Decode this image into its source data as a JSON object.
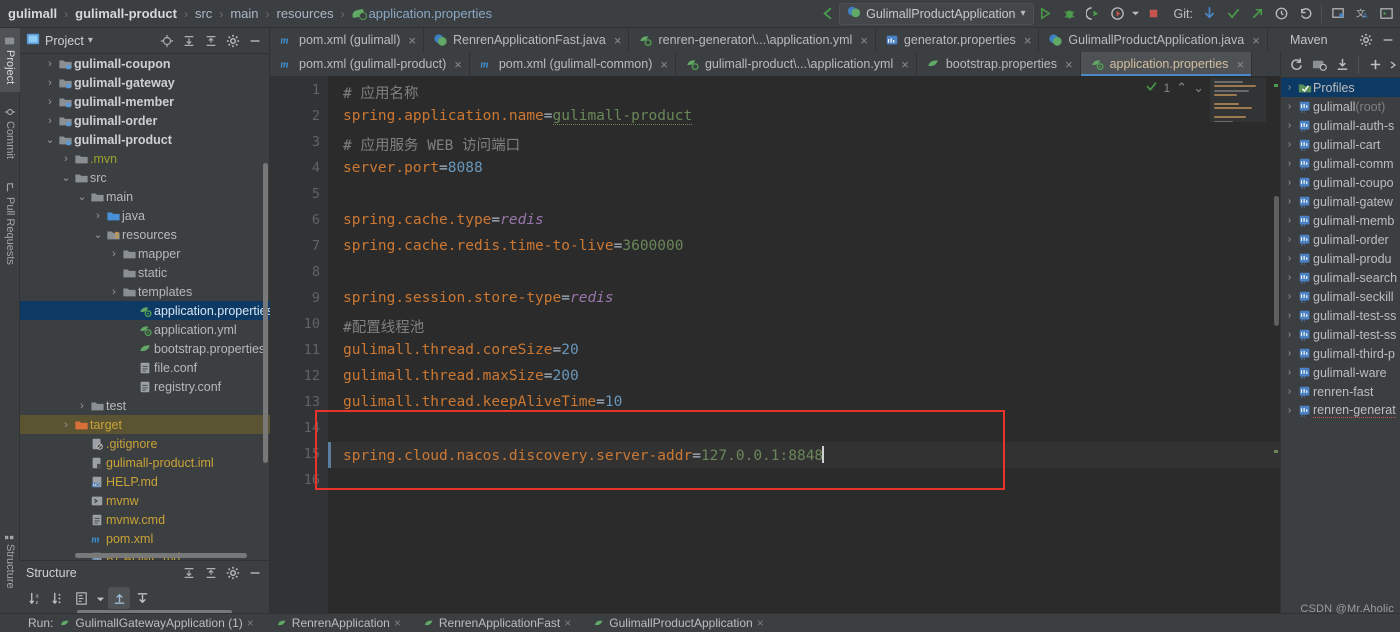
{
  "breadcrumb": {
    "items": [
      "gulimall",
      "gulimall-product",
      "src",
      "main",
      "resources",
      "application.properties"
    ],
    "separator": "›"
  },
  "toolbar": {
    "run_config": "GulimallProductApplication",
    "dropdown_caret": "▾",
    "git_label": "Git:",
    "icons": [
      "back-arrow-icon",
      "run-icon",
      "debug-icon",
      "run-with-coverage-icon",
      "profile-icon",
      "stop-icon",
      "git-update-icon",
      "git-commit-icon",
      "git-push-icon",
      "git-history-icon",
      "git-rollback-icon",
      "search-everywhere-icon",
      "translate-icon",
      "layout-icon"
    ]
  },
  "left_rail": {
    "items": [
      {
        "label": "Project",
        "selected": true
      },
      {
        "label": "Commit",
        "selected": false
      },
      {
        "label": "Pull Requests",
        "selected": false
      }
    ],
    "structure_label": "Structure"
  },
  "project_panel": {
    "title": "Project",
    "caret": "▾",
    "header_icons": [
      "locate-icon",
      "expand-all-icon",
      "collapse-all-icon",
      "settings-icon",
      "hide-icon"
    ],
    "tree": [
      {
        "label": "gulimall-coupon",
        "indent": 1,
        "arrow": "›",
        "icon": "module-folder-icon",
        "bold": true
      },
      {
        "label": "gulimall-gateway",
        "indent": 1,
        "arrow": "›",
        "icon": "module-folder-icon",
        "bold": true
      },
      {
        "label": "gulimall-member",
        "indent": 1,
        "arrow": "›",
        "icon": "module-folder-icon",
        "bold": true
      },
      {
        "label": "gulimall-order",
        "indent": 1,
        "arrow": "›",
        "icon": "module-folder-icon",
        "bold": true
      },
      {
        "label": "gulimall-product",
        "indent": 1,
        "arrow": "⌄",
        "icon": "module-folder-icon",
        "bold": true
      },
      {
        "label": ".mvn",
        "indent": 2,
        "arrow": "›",
        "icon": "folder-icon",
        "color": "green"
      },
      {
        "label": "src",
        "indent": 2,
        "arrow": "⌄",
        "icon": "folder-icon"
      },
      {
        "label": "main",
        "indent": 3,
        "arrow": "⌄",
        "icon": "folder-icon"
      },
      {
        "label": "java",
        "indent": 4,
        "arrow": "›",
        "icon": "source-folder-icon"
      },
      {
        "label": "resources",
        "indent": 4,
        "arrow": "⌄",
        "icon": "resources-folder-icon"
      },
      {
        "label": "mapper",
        "indent": 5,
        "arrow": "›",
        "icon": "folder-icon"
      },
      {
        "label": "static",
        "indent": 5,
        "arrow": "",
        "icon": "folder-icon"
      },
      {
        "label": "templates",
        "indent": 5,
        "arrow": "›",
        "icon": "folder-icon"
      },
      {
        "label": "application.properties",
        "indent": 6,
        "arrow": "",
        "icon": "spring-properties-icon",
        "selected": true
      },
      {
        "label": "application.yml",
        "indent": 6,
        "arrow": "",
        "icon": "spring-properties-icon"
      },
      {
        "label": "bootstrap.properties",
        "indent": 6,
        "arrow": "",
        "icon": "spring-leaf-icon"
      },
      {
        "label": "file.conf",
        "indent": 6,
        "arrow": "",
        "icon": "conf-file-icon"
      },
      {
        "label": "registry.conf",
        "indent": 6,
        "arrow": "",
        "icon": "conf-file-icon"
      },
      {
        "label": "test",
        "indent": 3,
        "arrow": "›",
        "icon": "folder-icon"
      },
      {
        "label": "target",
        "indent": 2,
        "arrow": "›",
        "icon": "excluded-folder-icon",
        "color": "orange",
        "highlight": true
      },
      {
        "label": ".gitignore",
        "indent": 3,
        "arrow": "",
        "icon": "gitignore-icon",
        "color": "orange"
      },
      {
        "label": "gulimall-product.iml",
        "indent": 3,
        "arrow": "",
        "icon": "iml-file-icon",
        "color": "orange"
      },
      {
        "label": "HELP.md",
        "indent": 3,
        "arrow": "",
        "icon": "markdown-icon",
        "color": "orange"
      },
      {
        "label": "mvnw",
        "indent": 3,
        "arrow": "",
        "icon": "shell-script-icon",
        "color": "orange"
      },
      {
        "label": "mvnw.cmd",
        "indent": 3,
        "arrow": "",
        "icon": "cmd-script-icon",
        "color": "orange"
      },
      {
        "label": "pom.xml",
        "indent": 3,
        "arrow": "",
        "icon": "maven-pom-icon",
        "color": "orange"
      },
      {
        "label": "README.md",
        "indent": 3,
        "arrow": "",
        "icon": "markdown-icon",
        "color": "orange"
      }
    ]
  },
  "structure_panel": {
    "title": "Structure",
    "header_icons": [
      "expand-all-icon",
      "collapse-all-icon",
      "settings-icon",
      "hide-icon"
    ],
    "toolbar_icons": [
      "sort-alphabetically-icon",
      "sort-by-type-icon",
      "show-properties-icon",
      "more-icon",
      "scroll-from-source-icon",
      "scroll-to-source-icon"
    ]
  },
  "editor_tabs": {
    "row1": [
      {
        "label": "pom.xml (gulimall)",
        "icon": "maven-pom-icon",
        "active": false,
        "closable": true
      },
      {
        "label": "RenrenApplicationFast.java",
        "icon": "spring-java-icon",
        "active": false,
        "closable": true
      },
      {
        "label": "renren-generator\\...\\application.yml",
        "icon": "spring-yml-icon",
        "active": false,
        "closable": true
      },
      {
        "label": "generator.properties",
        "icon": "properties-icon",
        "active": false,
        "closable": true
      },
      {
        "label": "GulimallProductApplication.java",
        "icon": "spring-java-icon",
        "active": false,
        "closable": true
      }
    ],
    "row2": [
      {
        "label": "pom.xml (gulimall-product)",
        "icon": "maven-pom-icon",
        "active": false,
        "closable": true
      },
      {
        "label": "pom.xml (gulimall-common)",
        "icon": "maven-pom-icon",
        "active": false,
        "closable": true
      },
      {
        "label": "gulimall-product\\...\\application.yml",
        "icon": "spring-yml-icon",
        "active": false,
        "closable": true
      },
      {
        "label": "bootstrap.properties",
        "icon": "spring-leaf-icon",
        "active": false,
        "closable": true
      },
      {
        "label": "application.properties",
        "icon": "spring-properties-icon",
        "active": true,
        "closable": true
      }
    ],
    "maven_tab_label": "Maven"
  },
  "editor": {
    "inspection_count": "1",
    "inspection_up": "⌃",
    "inspection_down": "⌄",
    "lines": [
      {
        "no": "1",
        "segments": [
          {
            "t": "# 应用名称",
            "c": "cmt"
          }
        ]
      },
      {
        "no": "2",
        "segments": [
          {
            "t": "spring.application.name",
            "c": "k"
          },
          {
            "t": "=",
            "c": "punc"
          },
          {
            "t": "gulimall-product",
            "c": "s squig"
          }
        ]
      },
      {
        "no": "3",
        "segments": [
          {
            "t": "# 应用服务 WEB 访问端口",
            "c": "cmt"
          }
        ]
      },
      {
        "no": "4",
        "segments": [
          {
            "t": "server.port",
            "c": "k"
          },
          {
            "t": "=",
            "c": "punc"
          },
          {
            "t": "8088",
            "c": "n"
          }
        ]
      },
      {
        "no": "5",
        "segments": []
      },
      {
        "no": "6",
        "segments": [
          {
            "t": "spring.cache.type",
            "c": "k"
          },
          {
            "t": "=",
            "c": "punc"
          },
          {
            "t": "redis",
            "c": "v"
          }
        ]
      },
      {
        "no": "7",
        "segments": [
          {
            "t": "spring.cache.redis.time-to-live",
            "c": "k"
          },
          {
            "t": "=",
            "c": "punc"
          },
          {
            "t": "3600000",
            "c": "s"
          }
        ]
      },
      {
        "no": "8",
        "segments": []
      },
      {
        "no": "9",
        "segments": [
          {
            "t": "spring.session.store-type",
            "c": "k"
          },
          {
            "t": "=",
            "c": "punc"
          },
          {
            "t": "redis",
            "c": "v"
          }
        ]
      },
      {
        "no": "10",
        "segments": [
          {
            "t": "#配置线程池",
            "c": "cmt"
          }
        ]
      },
      {
        "no": "11",
        "segments": [
          {
            "t": "gulimall.thread.coreSize",
            "c": "k"
          },
          {
            "t": "=",
            "c": "punc"
          },
          {
            "t": "20",
            "c": "n"
          }
        ]
      },
      {
        "no": "12",
        "segments": [
          {
            "t": "gulimall.thread.maxSize",
            "c": "k"
          },
          {
            "t": "=",
            "c": "punc"
          },
          {
            "t": "200",
            "c": "n"
          }
        ]
      },
      {
        "no": "13",
        "segments": [
          {
            "t": "gulimall.thread.keepAliveTime",
            "c": "k"
          },
          {
            "t": "=",
            "c": "punc"
          },
          {
            "t": "10",
            "c": "n"
          }
        ]
      },
      {
        "no": "14",
        "segments": []
      },
      {
        "no": "15",
        "segments": [
          {
            "t": "spring.cloud.nacos.discovery.server-addr",
            "c": "k"
          },
          {
            "t": "=",
            "c": "punc"
          },
          {
            "t": "127.0.0.1:8848",
            "c": "s"
          }
        ],
        "current": true,
        "caret": true
      },
      {
        "no": "16",
        "segments": []
      }
    ],
    "annotation": {
      "name": "red-highlight-box",
      "color": "#e8342a",
      "from_line": 14,
      "to_line": 16
    }
  },
  "maven_panel": {
    "title": "Maven",
    "toolbar_icons": [
      "reload-icon",
      "add-maven-project-icon",
      "download-sources-icon",
      "add-icon",
      "more-icon"
    ],
    "tree": [
      {
        "label": "Profiles",
        "icon": "profiles-icon",
        "selected": true
      },
      {
        "label": "gulimall",
        "suffix": " (root)",
        "icon": "maven-module-icon"
      },
      {
        "label": "gulimall-auth-s",
        "icon": "maven-module-icon"
      },
      {
        "label": "gulimall-cart",
        "icon": "maven-module-icon"
      },
      {
        "label": "gulimall-comm",
        "icon": "maven-module-icon"
      },
      {
        "label": "gulimall-coupo",
        "icon": "maven-module-icon"
      },
      {
        "label": "gulimall-gatew",
        "icon": "maven-module-icon"
      },
      {
        "label": "gulimall-memb",
        "icon": "maven-module-icon"
      },
      {
        "label": "gulimall-order",
        "icon": "maven-module-icon"
      },
      {
        "label": "gulimall-produ",
        "icon": "maven-module-icon"
      },
      {
        "label": "gulimall-search",
        "icon": "maven-module-icon"
      },
      {
        "label": "gulimall-seckill",
        "icon": "maven-module-icon"
      },
      {
        "label": "gulimall-test-ss",
        "icon": "maven-module-icon"
      },
      {
        "label": "gulimall-test-ss",
        "icon": "maven-module-icon"
      },
      {
        "label": "gulimall-third-p",
        "icon": "maven-module-icon"
      },
      {
        "label": "gulimall-ware",
        "icon": "maven-module-icon"
      },
      {
        "label": "renren-fast",
        "icon": "maven-module-icon"
      },
      {
        "label": "renren-generat",
        "icon": "maven-module-icon",
        "error": true
      }
    ]
  },
  "run_bar": {
    "label": "Run:",
    "tabs": [
      "GulimallGatewayApplication (1)",
      "RenrenApplication",
      "RenrenApplicationFast",
      "GulimallProductApplication"
    ]
  },
  "watermark": "CSDN @Mr.Aholic",
  "colors": {
    "panel_bg": "#3c3f41",
    "editor_bg": "#2b2b2b",
    "gutter_bg": "#313335",
    "selection_blue": "#0d3a64",
    "tab_active": "#4e5254",
    "accent_underline": "#4a88c7",
    "annotation_red": "#e8342a",
    "keyword_orange": "#cc7832",
    "string_green": "#6a8759",
    "number_blue": "#6897bb",
    "value_purple": "#9876aa",
    "comment_gray": "#808080"
  }
}
